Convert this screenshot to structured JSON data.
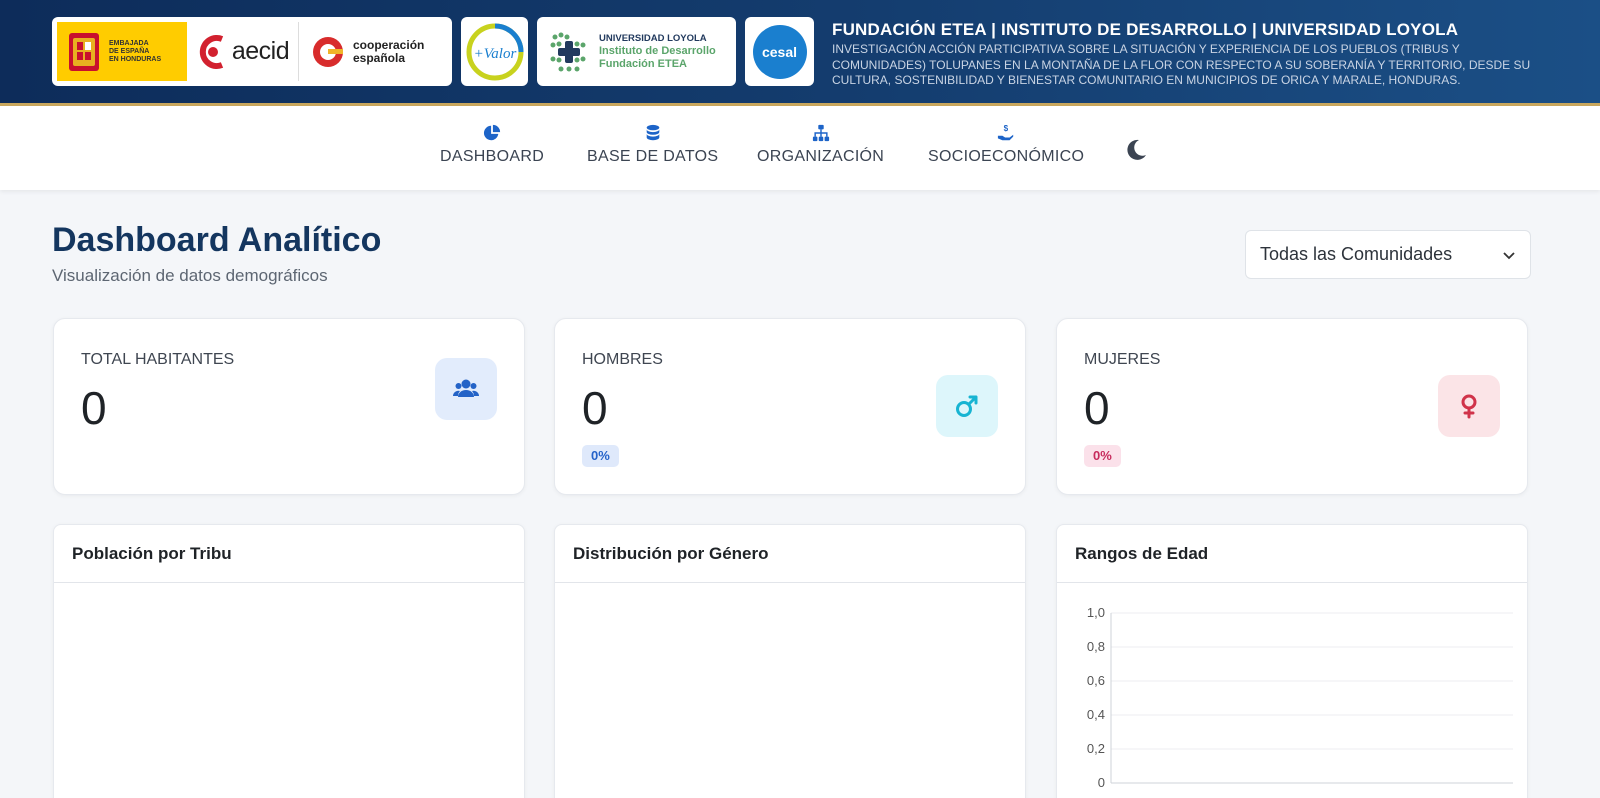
{
  "header": {
    "logos": {
      "embajada": "EMBAJADA\nDE ESPAÑA\nEN HONDURAS",
      "aecid": "aecid",
      "cooperacion": "cooperación\nespañola",
      "loyola_line1": "UNIVERSIDAD LOYOLA",
      "loyola_line2": "Instituto de Desarrollo",
      "loyola_line3": "Fundación ETEA",
      "cesal": "cesal"
    },
    "title": "FUNDACIÓN ETEA | INSTITUTO DE DESARROLLO | UNIVERSIDAD LOYOLA",
    "subtitle": "INVESTIGACIÓN ACCIÓN PARTICIPATIVA SOBRE LA SITUACIÓN Y EXPERIENCIA DE LOS PUEBLOS (TRIBUS Y COMUNIDADES) TOLUPANES EN LA MONTAÑA DE LA FLOR CON RESPECTO A SU SOBERANÍA Y TERRITORIO, DESDE SU CULTURA, SOSTENIBILIDAD Y BIENESTAR COMUNITARIO EN MUNICIPIOS DE ORICA Y MARALE, HONDURAS."
  },
  "nav": {
    "dashboard": "DASHBOARD",
    "base_datos": "BASE DE DATOS",
    "organizacion": "ORGANIZACIÓN",
    "socioeconomico": "SOCIOECONÓMICO",
    "icons": [
      "chart-pie-icon",
      "database-icon",
      "sitemap-icon",
      "hand-holding-dollar-icon",
      "moon-icon"
    ]
  },
  "page": {
    "title": "Dashboard Analítico",
    "subtitle": "Visualización de datos demográficos",
    "community_select": "Todas las Comunidades"
  },
  "stats": {
    "total": {
      "label": "TOTAL HABITANTES",
      "value": "0",
      "icon": "users-icon"
    },
    "hombres": {
      "label": "HOMBRES",
      "value": "0",
      "badge": "0%",
      "icon": "mars-icon"
    },
    "mujeres": {
      "label": "MUJERES",
      "value": "0",
      "badge": "0%",
      "icon": "venus-icon"
    }
  },
  "charts": {
    "tribu_title": "Población por Tribu",
    "genero_title": "Distribución por Género",
    "edad_title": "Rangos de Edad"
  },
  "chart_data": {
    "type": "bar",
    "title": "Rangos de Edad",
    "categories": [],
    "values": [],
    "y_ticks": [
      "0",
      "0,2",
      "0,4",
      "0,6",
      "0,8",
      "1,0"
    ],
    "ylim": [
      0,
      1.0
    ],
    "grid": true
  },
  "colors": {
    "banner": "#0d2c5a",
    "title_blue": "#14365f",
    "accent_gold": "#c9a75d",
    "male_cyan": "#17b4d2",
    "female_red": "#d0334a",
    "users_blue": "#2463c7"
  }
}
